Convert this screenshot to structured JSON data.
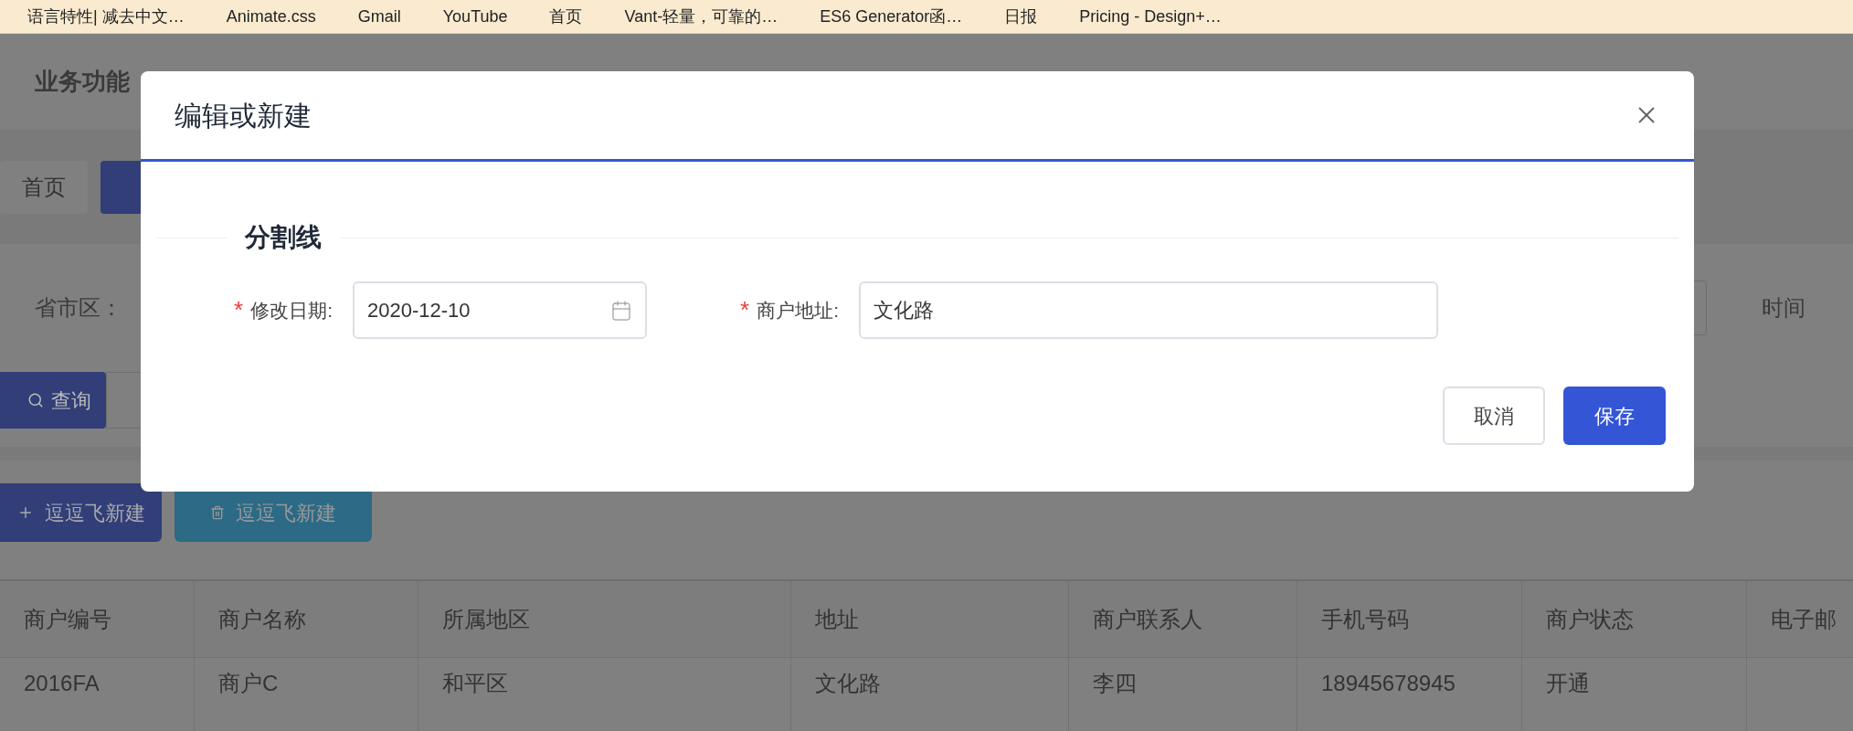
{
  "bookmarks": [
    {
      "label": "语言特性| 减去中文…"
    },
    {
      "label": "Animate.css"
    },
    {
      "label": "Gmail"
    },
    {
      "label": "YouTube"
    },
    {
      "label": "首页"
    },
    {
      "label": "Vant-轻量，可靠的…"
    },
    {
      "label": "ES6 Generator函…"
    },
    {
      "label": "日报"
    },
    {
      "label": "Pricing - Design+…"
    }
  ],
  "page": {
    "title": "业务功能",
    "tabs": [
      {
        "label": "首页",
        "selected": false
      },
      {
        "selected": true
      }
    ],
    "filters": {
      "region_label": "省市区：",
      "time_label": "时间"
    },
    "query_button": "查询",
    "actions": [
      {
        "kind": "add",
        "label": "逗逗飞新建"
      },
      {
        "kind": "delete",
        "label": "逗逗飞新建"
      }
    ],
    "table": {
      "columns": [
        "商户编号",
        "商户名称",
        "所属地区",
        "地址",
        "商户联系人",
        "手机号码",
        "商户状态",
        "电子邮"
      ],
      "rows": [
        [
          "2016FA",
          "商户C",
          "和平区",
          "文化路",
          "李四",
          "18945678945",
          "开通"
        ]
      ]
    }
  },
  "dialog": {
    "title": "编辑或新建",
    "divider": "分割线",
    "fields": [
      {
        "kind": "date",
        "label": "修改日期:",
        "required_mark": "*",
        "value": "2020-12-10"
      },
      {
        "kind": "text",
        "label": "商户地址:",
        "required_mark": "*",
        "value": "文化路"
      }
    ],
    "buttons": [
      {
        "kind": "secondary",
        "label": "取消"
      },
      {
        "kind": "primary",
        "label": "保存"
      }
    ]
  }
}
